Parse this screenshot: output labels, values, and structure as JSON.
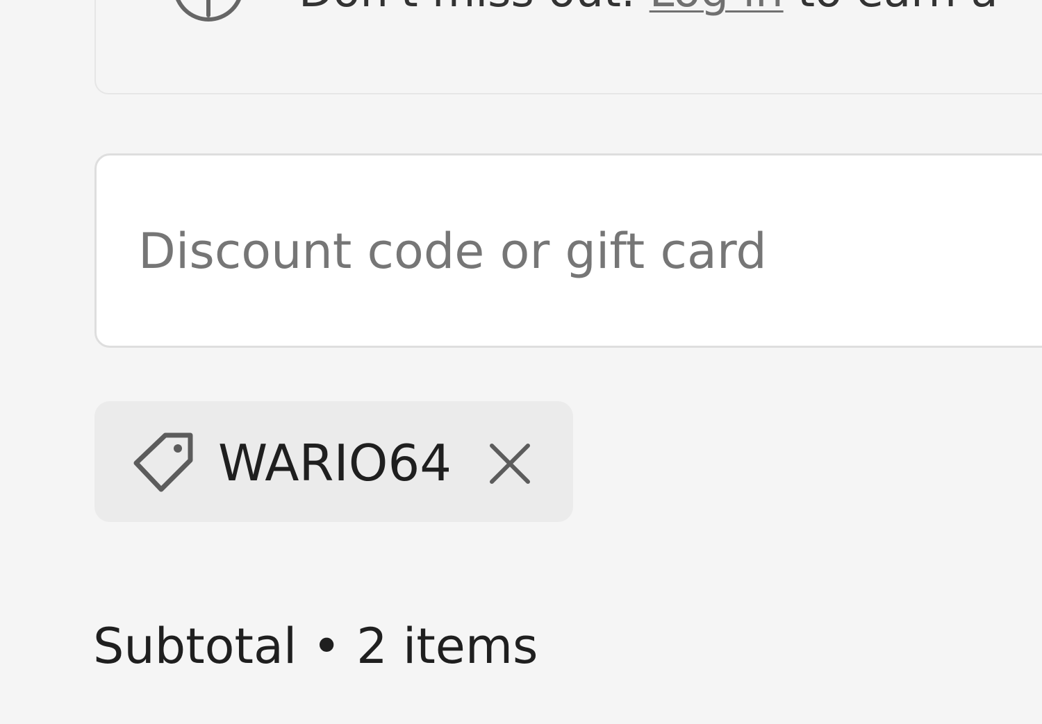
{
  "banner": {
    "icon": "info-icon",
    "text_before": "Don't miss out. ",
    "link_text": "Log in",
    "text_after": " to earn a"
  },
  "discount": {
    "placeholder": "Discount code or gift card",
    "value": ""
  },
  "applied_code": {
    "icon": "tag-icon",
    "code": "WARIO64",
    "remove_icon": "close-icon"
  },
  "summary": {
    "subtotal_label": "Subtotal",
    "separator": " • ",
    "items_count": "2 items"
  },
  "colors": {
    "background": "#f5f5f5",
    "input_background": "#ffffff",
    "tag_background": "#ebebeb",
    "text": "#1f1f1f",
    "placeholder": "#767676",
    "icon": "#5c5c5c"
  }
}
